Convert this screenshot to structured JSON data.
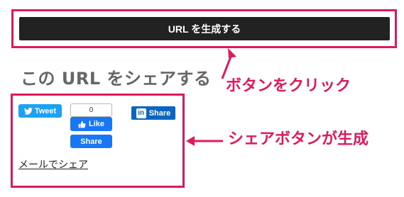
{
  "generate_button": {
    "label": "URL を生成する"
  },
  "share_section": {
    "heading": "この URL をシェアする",
    "tweet_label": "Tweet",
    "fb_count": "0",
    "fb_like_label": "Like",
    "fb_share_label": "Share",
    "linkedin_label": "Share",
    "linkedin_logo": "in",
    "mail_label": "メールでシェア"
  },
  "annotations": {
    "click_button": "ボタンをクリック",
    "buttons_generated": "シェアボタンが生成"
  },
  "colors": {
    "highlight": "#e0195e",
    "twitter": "#1da1f2",
    "facebook": "#1877f2",
    "linkedin": "#0a66c2"
  },
  "icons": [
    "twitter-bird-icon",
    "thumbs-up-icon",
    "linkedin-icon",
    "arrow-icon"
  ]
}
